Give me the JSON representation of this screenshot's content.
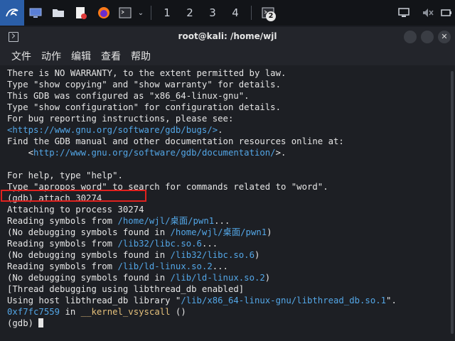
{
  "taskbar": {
    "workspaces": [
      "1",
      "2",
      "3",
      "4"
    ],
    "notification_count": "2"
  },
  "window": {
    "title": "root@kali: /home/wjl",
    "close_symbol": "✕"
  },
  "menu": [
    "文件",
    "动作",
    "编辑",
    "查看",
    "帮助"
  ],
  "terminal": {
    "lines": [
      {
        "segments": [
          {
            "text": "There is NO WARRANTY, to the extent permitted by law."
          }
        ]
      },
      {
        "segments": [
          {
            "text": "Type \"show copying\" and \"show warranty\" for details."
          }
        ]
      },
      {
        "segments": [
          {
            "text": "This GDB was configured as \"x86_64-linux-gnu\"."
          }
        ]
      },
      {
        "segments": [
          {
            "text": "Type \"show configuration\" for configuration details."
          }
        ]
      },
      {
        "segments": [
          {
            "text": "For bug reporting instructions, please see:"
          }
        ]
      },
      {
        "segments": [
          {
            "text": "<https://www.gnu.org/software/gdb/bugs/>",
            "color": "blue"
          },
          {
            "text": "."
          }
        ]
      },
      {
        "segments": [
          {
            "text": "Find the GDB manual and other documentation resources online at:"
          }
        ]
      },
      {
        "segments": [
          {
            "text": "    <"
          },
          {
            "text": "http://www.gnu.org/software/gdb/documentation/",
            "color": "blue"
          },
          {
            "text": ">."
          }
        ]
      },
      {
        "segments": [
          {
            "text": ""
          }
        ]
      },
      {
        "segments": [
          {
            "text": "For help, type \"help\"."
          }
        ]
      },
      {
        "segments": [
          {
            "text": "Type \"apropos word\" to search for commands related to \"word\"."
          }
        ]
      },
      {
        "segments": [
          {
            "text": "(gdb) attach 30274"
          }
        ]
      },
      {
        "segments": [
          {
            "text": "Attaching to process 30274"
          }
        ]
      },
      {
        "segments": [
          {
            "text": "Reading symbols from "
          },
          {
            "text": "/home/wjl/桌面/pwn1",
            "color": "blue"
          },
          {
            "text": "..."
          }
        ]
      },
      {
        "segments": [
          {
            "text": "(No debugging symbols found in "
          },
          {
            "text": "/home/wjl/桌面/pwn1",
            "color": "blue"
          },
          {
            "text": ")"
          }
        ]
      },
      {
        "segments": [
          {
            "text": "Reading symbols from "
          },
          {
            "text": "/lib32/libc.so.6",
            "color": "blue"
          },
          {
            "text": "..."
          }
        ]
      },
      {
        "segments": [
          {
            "text": "(No debugging symbols found in "
          },
          {
            "text": "/lib32/libc.so.6",
            "color": "blue"
          },
          {
            "text": ")"
          }
        ]
      },
      {
        "segments": [
          {
            "text": "Reading symbols from "
          },
          {
            "text": "/lib/ld-linux.so.2",
            "color": "blue"
          },
          {
            "text": "..."
          }
        ]
      },
      {
        "segments": [
          {
            "text": "(No debugging symbols found in "
          },
          {
            "text": "/lib/ld-linux.so.2",
            "color": "blue"
          },
          {
            "text": ")"
          }
        ]
      },
      {
        "segments": [
          {
            "text": "[Thread debugging using libthread_db enabled]"
          }
        ]
      },
      {
        "segments": [
          {
            "text": "Using host libthread_db library \""
          },
          {
            "text": "/lib/x86_64-linux-gnu/libthread_db.so.1",
            "color": "blue"
          },
          {
            "text": "\"."
          }
        ]
      },
      {
        "segments": [
          {
            "text": "0xf7fc7559",
            "color": "blue"
          },
          {
            "text": " in "
          },
          {
            "text": "__kernel_vsyscall",
            "color": "yellow"
          },
          {
            "text": " ()"
          }
        ]
      },
      {
        "segments": [
          {
            "text": "(gdb) "
          }
        ]
      }
    ]
  },
  "colors": {
    "blue": "#53a6e6",
    "yellow": "#e5c07b",
    "highlight": "#e0211e"
  }
}
